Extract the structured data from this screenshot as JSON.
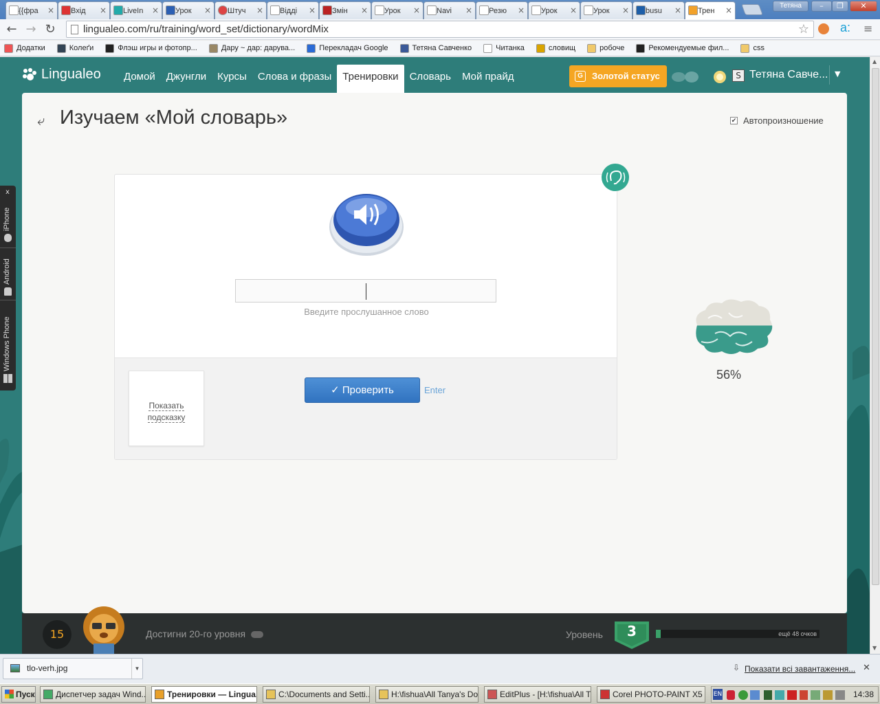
{
  "browser": {
    "tabs": [
      {
        "label": "{{фра",
        "icon": "doc-icon"
      },
      {
        "label": "Вхід",
        "icon": "gmail-icon"
      },
      {
        "label": "LiveIn",
        "icon": "chat-icon"
      },
      {
        "label": "Урок",
        "icon": "word-icon"
      },
      {
        "label": "Штуч",
        "icon": "red-circle-icon"
      },
      {
        "label": "Відді",
        "icon": "doc-icon"
      },
      {
        "label": "Змін",
        "icon": "znu-icon"
      },
      {
        "label": "Урок",
        "icon": "doc-icon"
      },
      {
        "label": "Navi",
        "icon": "doc-icon"
      },
      {
        "label": "Резю",
        "icon": "doc-icon"
      },
      {
        "label": "Урок",
        "icon": "doc-icon"
      },
      {
        "label": "Урок",
        "icon": "doc-icon"
      },
      {
        "label": "busu",
        "icon": "busuu-icon"
      },
      {
        "label": "Трен",
        "icon": "lingualeo-icon",
        "active": true
      }
    ],
    "profile_name": "Тетяна",
    "url": "lingualeo.com/ru/training/word_set/dictionary/wordMix",
    "bookmarks": [
      {
        "label": "Додатки",
        "icon": "apps-grid-icon"
      },
      {
        "label": "Колеґи",
        "icon": "person-icon"
      },
      {
        "label": "Флэш игры и фотопр...",
        "icon": "flash-icon"
      },
      {
        "label": "Дару ~ дар: дарува...",
        "icon": "bird-icon"
      },
      {
        "label": "Перекладач Google",
        "icon": "translate-icon"
      },
      {
        "label": "Тетяна Савченко",
        "icon": "facebook-icon"
      },
      {
        "label": "Читанка",
        "icon": "page-icon"
      },
      {
        "label": "словищ",
        "icon": "crown-icon"
      },
      {
        "label": "робоче",
        "icon": "folder-icon"
      },
      {
        "label": "Рекомендуемые фил...",
        "icon": "letter-i-icon"
      },
      {
        "label": "css",
        "icon": "folder-icon"
      }
    ]
  },
  "site": {
    "logo_text": "Lingualeo",
    "nav": [
      {
        "label": "Домой",
        "active": false
      },
      {
        "label": "Джунгли",
        "active": false
      },
      {
        "label": "Курсы",
        "active": false
      },
      {
        "label": "Слова и фразы",
        "active": false
      },
      {
        "label": "Тренировки",
        "active": true
      },
      {
        "label": "Словарь",
        "active": false
      },
      {
        "label": "Мой прайд",
        "active": false
      }
    ],
    "gold_badge": "G",
    "gold_label": "Золотой статус",
    "user_name": "Тетяна Савче...",
    "colors": {
      "brand_teal": "#2e7d7a",
      "gold": "#f5a623",
      "button_blue": "#3b82cc",
      "progress_green": "#3aa169"
    }
  },
  "training": {
    "title": "Изучаем «Мой словарь»",
    "autopronounce_label": "Автопроизношение",
    "autopronounce_checked": true,
    "answer_value": "",
    "input_hint": "Введите прослушанное слово",
    "show_hint_label": "Показать подсказку",
    "check_label": "Проверить",
    "enter_label": "Enter",
    "brain_percent": "56%",
    "brain_fraction": 0.56
  },
  "footer": {
    "user_level": "15",
    "goal_text": "Достигни 20-го уровня",
    "level_label": "Уровень",
    "level_value": "3",
    "points_left": "ещё 48 очков",
    "level_progress": 0.03
  },
  "side_widget": {
    "close": "x",
    "items": [
      "iPhone",
      "Android",
      "Windows Phone"
    ]
  },
  "downloads": {
    "file_name": "tlo-verh.jpg",
    "show_all": "Показати всі завантаження...",
    "close": "✕"
  },
  "taskbar": {
    "start": "Пуск",
    "tasks": [
      {
        "label": "Диспетчер задач Wind...",
        "active": false
      },
      {
        "label": "Тренировки — Lingua...",
        "active": true
      },
      {
        "label": "C:\\Documents and Setti...",
        "active": false
      },
      {
        "label": "H:\\fishua\\All Tanya's Do...",
        "active": false
      },
      {
        "label": "EditPlus - [H:\\fishua\\All T...",
        "active": false
      },
      {
        "label": "Corel PHOTO-PAINT X5",
        "active": false
      }
    ],
    "lang": "EN",
    "time": "14:38"
  }
}
